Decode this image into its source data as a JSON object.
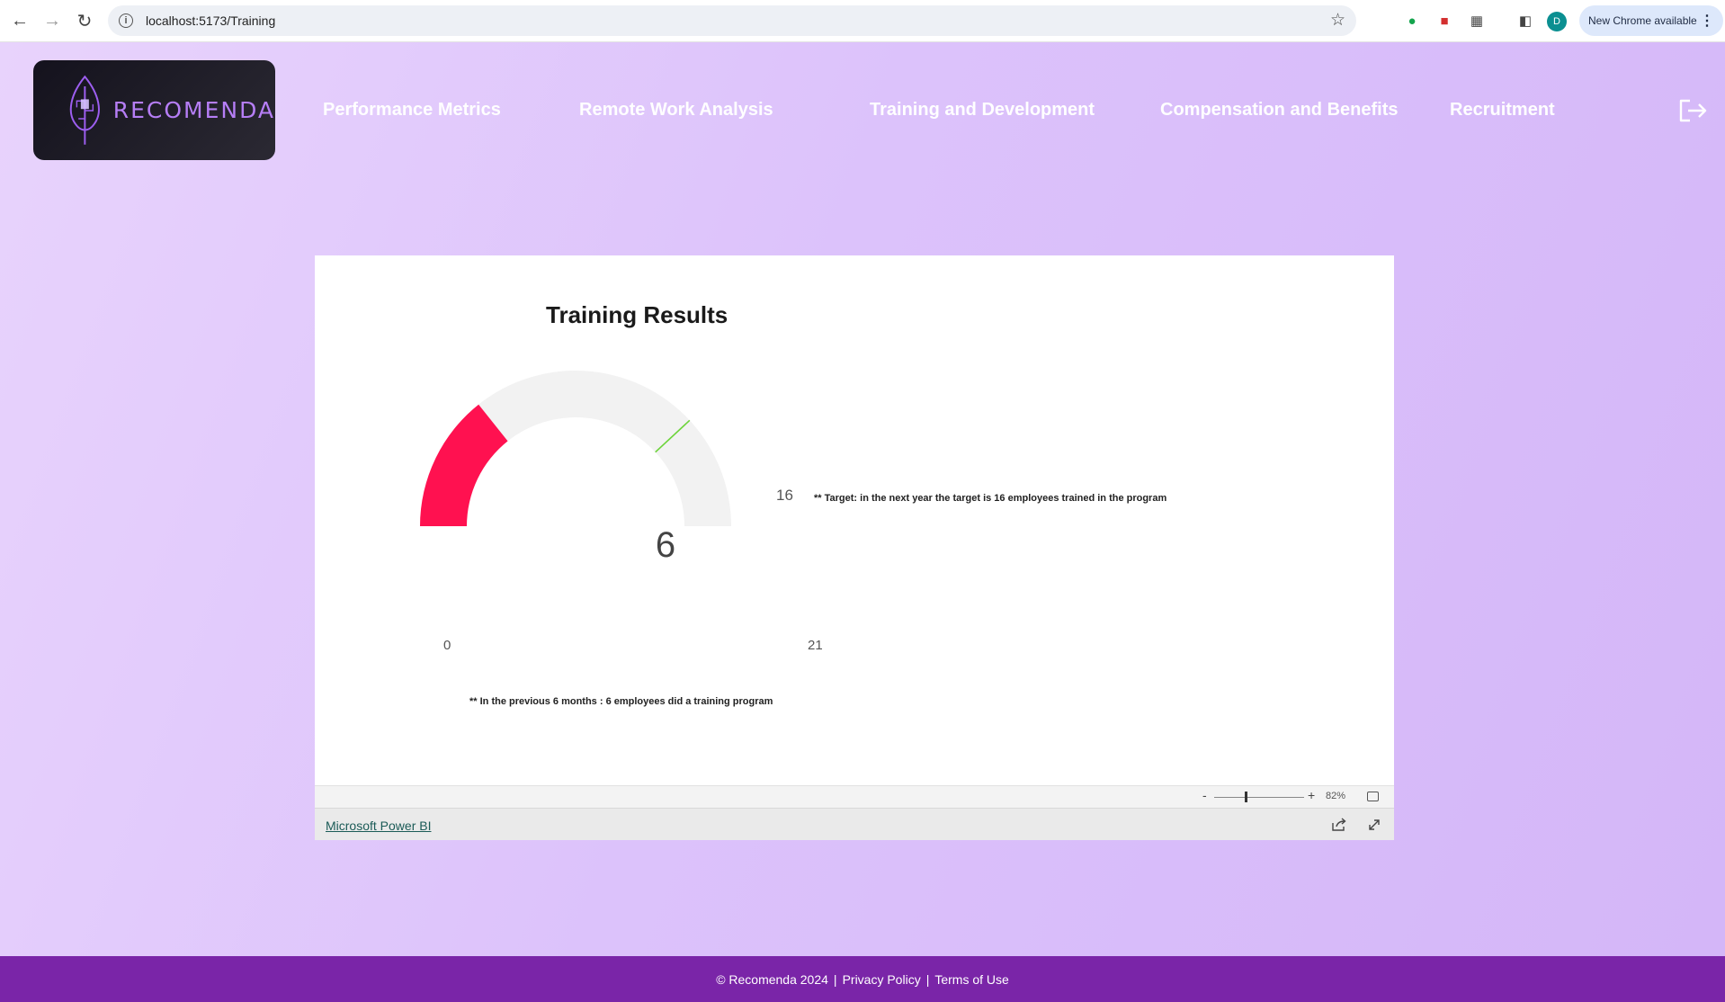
{
  "browser": {
    "url": "localhost:5173/Training",
    "update_label": "New Chrome available",
    "profile_initial": "D"
  },
  "header": {
    "logo_text": "RECOMENDA",
    "nav": [
      {
        "label": "Performance Metrics"
      },
      {
        "label": "Remote Work Analysis"
      },
      {
        "label": "Training and Development"
      },
      {
        "label": "Compensation and Benefits"
      },
      {
        "label": "Recruitment"
      }
    ]
  },
  "report": {
    "title": "Training Results",
    "gauge": {
      "value": "6",
      "min": "0",
      "max": "21",
      "target": "16",
      "value_color": "#ff1150",
      "track_color": "#f2f2f2",
      "target_color": "#6cd43a"
    },
    "target_note": "** Target: in the next year the target is 16 employees trained in the program",
    "previous_note": "** In the previous 6 months : 6 employees did a training program",
    "zoom": {
      "minus": "-",
      "plus": "+",
      "percent": "82%",
      "level": 0.35
    },
    "powerbi_link": "Microsoft Power BI"
  },
  "footer": {
    "copyright": "© Recomenda 2024",
    "separator": "|",
    "privacy": "Privacy Policy",
    "terms": "Terms of Use"
  }
}
